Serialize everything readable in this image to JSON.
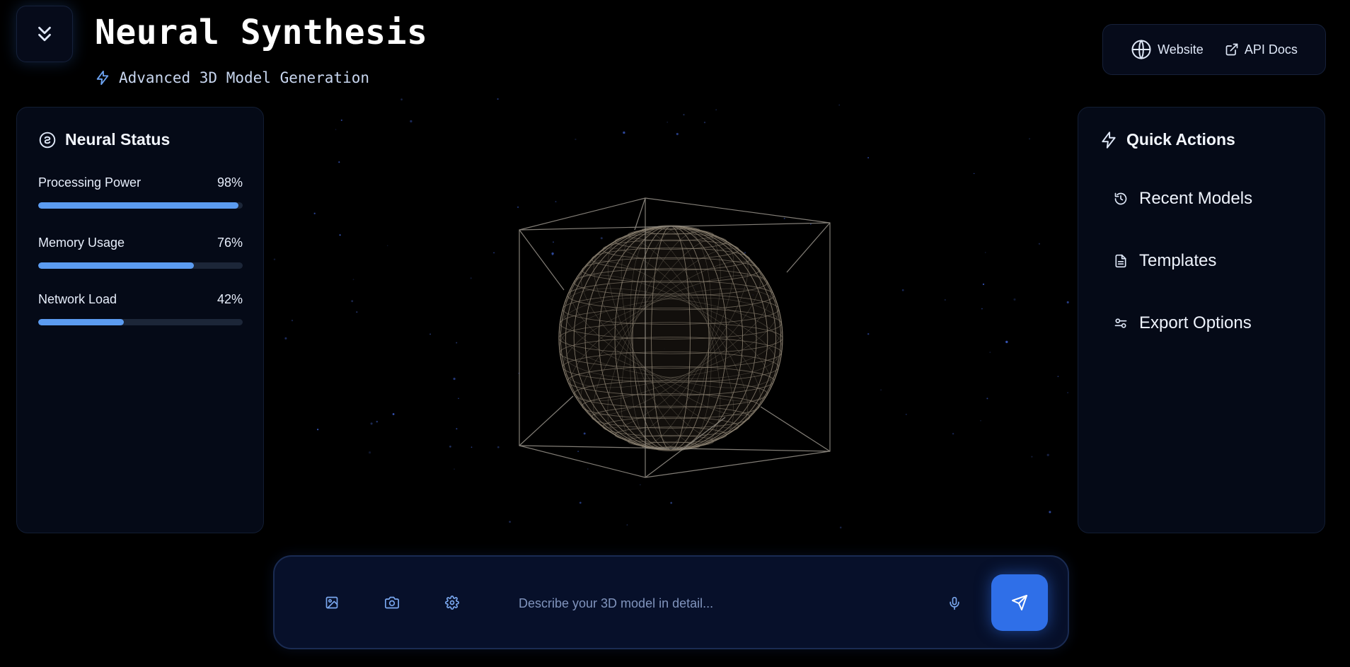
{
  "header": {
    "title": "Neural Synthesis",
    "subtitle": "Advanced 3D Model Generation",
    "collapse_icon": "chevrons-down-icon",
    "subtitle_icon": "bolt-icon"
  },
  "links": [
    {
      "label": "Website",
      "icon": "globe-icon"
    },
    {
      "label": "API Docs",
      "icon": "external-link-icon"
    }
  ],
  "status_panel": {
    "title": "Neural Status",
    "icon": "brain-icon",
    "metrics": [
      {
        "label": "Processing Power",
        "value": "98%",
        "level": 0.98
      },
      {
        "label": "Memory Usage",
        "value": "76%",
        "level": 0.76
      },
      {
        "label": "Network Load",
        "value": "42%",
        "level": 0.42
      }
    ]
  },
  "quick_actions": {
    "title": "Quick Actions",
    "icon": "bolt-icon",
    "items": [
      {
        "label": "Recent Models",
        "icon": "history-icon"
      },
      {
        "label": "Templates",
        "icon": "document-icon"
      },
      {
        "label": "Export Options",
        "icon": "sliders-icon"
      }
    ]
  },
  "prompt": {
    "placeholder": "Describe your 3D model in detail...",
    "value": "",
    "tools": [
      "image-icon",
      "camera-icon",
      "settings-icon"
    ],
    "mic_icon": "microphone-icon",
    "send_icon": "send-icon"
  },
  "colors": {
    "background": "#000000",
    "panel": "#050a17",
    "accent": "#2f6fe8",
    "progress": "#5b9bf0",
    "wireframe": "#8a8071"
  }
}
